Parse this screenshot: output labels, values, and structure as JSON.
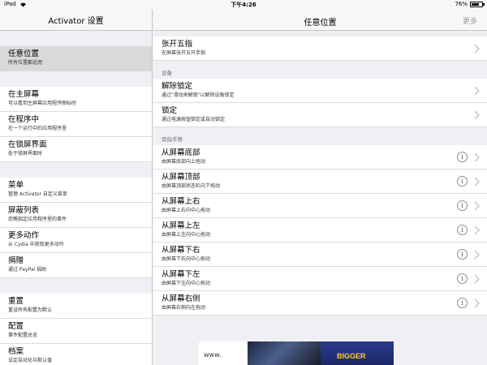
{
  "status": {
    "device": "iPad",
    "time": "下午4:26",
    "battery": "76%",
    "battery_level": 0.76
  },
  "left": {
    "title": "Activator 设置",
    "groups": [
      [
        {
          "title": "任意位置",
          "subtitle": "所有位置都适用",
          "selected": true
        }
      ],
      [
        {
          "title": "在主屏幕",
          "subtitle": "可以看到主屏幕应用程序图标时"
        },
        {
          "title": "在程序中",
          "subtitle": "在一个运行中的应用程序里"
        },
        {
          "title": "在锁屏界面",
          "subtitle": "处于锁屏界面时"
        }
      ],
      [
        {
          "title": "菜单",
          "subtitle": "管理 Activator 自定义菜单"
        },
        {
          "title": "屏蔽列表",
          "subtitle": "忽略指定应用程序里的事件"
        },
        {
          "title": "更多动作",
          "subtitle": "从 Cydia 中获取更多动作"
        },
        {
          "title": "捐赠",
          "subtitle": "通过 PayPal 捐助"
        }
      ],
      [
        {
          "title": "重置",
          "subtitle": "重设所有配置为默认"
        },
        {
          "title": "配置",
          "subtitle": "事件配置总览"
        },
        {
          "title": "档案",
          "subtitle": "设定自动化与默认值"
        }
      ]
    ]
  },
  "right": {
    "title": "任意位置",
    "more": "更多",
    "top_items": [
      {
        "title": "张开五指",
        "subtitle": "在屏幕张开五只手指"
      }
    ],
    "section_device": "设备",
    "device_items": [
      {
        "title": "解除锁定",
        "subtitle": "通过\"滑动来解锁\"以解除设备锁定"
      },
      {
        "title": "锁定",
        "subtitle": "通过电源按钮锁定或自动锁定"
      }
    ],
    "section_two_finger": "双指手势",
    "two_finger_items": [
      {
        "title": "从屏幕底部",
        "subtitle": "由屏幕底部向上拖动"
      },
      {
        "title": "从屏幕顶部",
        "subtitle": "由屏幕顶部状态栏向下拖动"
      },
      {
        "title": "从屏幕上右",
        "subtitle": "由屏幕上右向中心拖动"
      },
      {
        "title": "从屏幕上左",
        "subtitle": "由屏幕上左向中心拖动"
      },
      {
        "title": "从屏幕下右",
        "subtitle": "由屏幕下右向中心拖动"
      },
      {
        "title": "从屏幕下左",
        "subtitle": "由屏幕下左向中心拖动"
      },
      {
        "title": "从屏幕右侧",
        "subtitle": "由屏幕右侧向左拖动"
      }
    ],
    "info_glyph": "i"
  },
  "banner": {
    "url": "www.",
    "tag": "BIGGER"
  },
  "icons": {
    "wifi": "wifi-icon",
    "chevron": "chevron-right-icon",
    "info": "info-icon"
  }
}
